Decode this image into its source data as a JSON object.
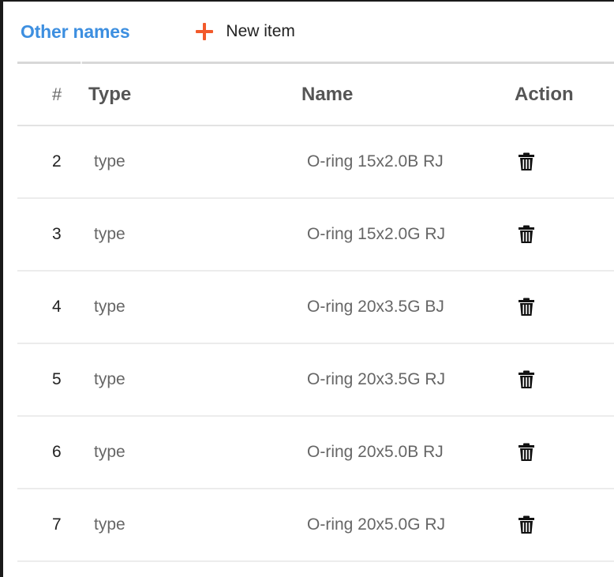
{
  "header": {
    "title": "Other names",
    "new_item_label": "New item"
  },
  "table": {
    "columns": [
      "#",
      "Type",
      "Name",
      "Action"
    ],
    "rows": [
      {
        "num": "2",
        "type": "type",
        "name": "O-ring 15x2.0B RJ"
      },
      {
        "num": "3",
        "type": "type",
        "name": "O-ring 15x2.0G RJ"
      },
      {
        "num": "4",
        "type": "type",
        "name": "O-ring 20x3.5G BJ"
      },
      {
        "num": "5",
        "type": "type",
        "name": "O-ring 20x3.5G RJ"
      },
      {
        "num": "6",
        "type": "type",
        "name": "O-ring 20x5.0B RJ"
      },
      {
        "num": "7",
        "type": "type",
        "name": "O-ring 20x5.0G RJ"
      }
    ]
  },
  "colors": {
    "title": "#3d8fe0",
    "plus": "#f25a2b",
    "trash": "#111111"
  },
  "icons": {
    "new_item": "plus-icon",
    "delete": "trash-icon"
  }
}
